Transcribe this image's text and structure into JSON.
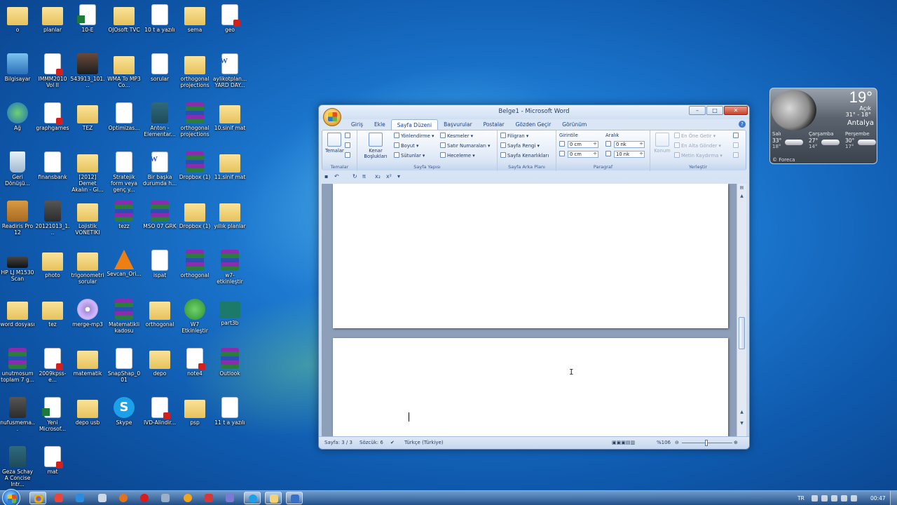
{
  "desktop": {
    "icons": [
      {
        "label": "o",
        "kind": "folder"
      },
      {
        "label": "planlar",
        "kind": "folder"
      },
      {
        "label": "10-E",
        "kind": "xls"
      },
      {
        "label": "OJOsoft TVC",
        "kind": "folder"
      },
      {
        "label": "10 t a yazılı",
        "kind": "doc"
      },
      {
        "label": "sema",
        "kind": "folder"
      },
      {
        "label": "geo",
        "kind": "pdf"
      },
      {
        "label": "Bilgisayar",
        "kind": "comp"
      },
      {
        "label": "IMMM2010 Vol II",
        "kind": "pdf"
      },
      {
        "label": "543913_101...",
        "kind": "photo"
      },
      {
        "label": "WMA To MP3 Co...",
        "kind": "folder"
      },
      {
        "label": "sorular",
        "kind": "doc"
      },
      {
        "label": "orthogonal projections",
        "kind": "folder"
      },
      {
        "label": "aylikotplan... YARD DAY...",
        "kind": "word"
      },
      {
        "label": "Ağ",
        "kind": "net"
      },
      {
        "label": "graphgames",
        "kind": "pdf"
      },
      {
        "label": "TEZ",
        "kind": "folder"
      },
      {
        "label": "Optimizas...",
        "kind": "doc"
      },
      {
        "label": "Anton - Elementar...",
        "kind": "book"
      },
      {
        "label": "orthogonal projections",
        "kind": "rar"
      },
      {
        "label": "10.sinif mat",
        "kind": "folder"
      },
      {
        "label": "Geri Dönüşü...",
        "kind": "bin"
      },
      {
        "label": "finansbank",
        "kind": "doc"
      },
      {
        "label": "[2012] Demet Akalın - Gi...",
        "kind": "folder"
      },
      {
        "label": "Stratejik form veya genç y...",
        "kind": "doc"
      },
      {
        "label": "Bir başka durumda h...",
        "kind": "word"
      },
      {
        "label": "Dropbox (1)",
        "kind": "rar"
      },
      {
        "label": "11.sinif mat",
        "kind": "folder"
      },
      {
        "label": "Readiris Pro 12",
        "kind": "box"
      },
      {
        "label": "20121013_1...",
        "kind": "dark"
      },
      {
        "label": "Lojistik VONETIKI",
        "kind": "folder"
      },
      {
        "label": "tezz",
        "kind": "rar"
      },
      {
        "label": "MSO 07 GRK",
        "kind": "rar"
      },
      {
        "label": "Dropbox (1)",
        "kind": "folder"
      },
      {
        "label": "yıllık planlar",
        "kind": "folder"
      },
      {
        "label": "HP LJ M1530 Scan",
        "kind": "scanner"
      },
      {
        "label": "photo",
        "kind": "folder"
      },
      {
        "label": "trigonometri sorular",
        "kind": "folder"
      },
      {
        "label": "Sevcan_Ori...",
        "kind": "vlc"
      },
      {
        "label": "ispat",
        "kind": "doc"
      },
      {
        "label": "orthogonal",
        "kind": "rar"
      },
      {
        "label": "w7-etkinleştir",
        "kind": "rar"
      },
      {
        "label": "word dosyası",
        "kind": "folder"
      },
      {
        "label": "tez",
        "kind": "folder"
      },
      {
        "label": "mergе-mp3",
        "kind": "disc"
      },
      {
        "label": "Matematikli kadosu",
        "kind": "rar"
      },
      {
        "label": "orthogonal",
        "kind": "folder"
      },
      {
        "label": "W7 Etkinleştir",
        "kind": "green"
      },
      {
        "label": "part3b",
        "kind": "teal"
      },
      {
        "label": "unutmosum toplam 7 g...",
        "kind": "rar"
      },
      {
        "label": "2009kpss-e...",
        "kind": "pdf"
      },
      {
        "label": "matematik",
        "kind": "folder"
      },
      {
        "label": "SnapShap_001",
        "kind": "doc"
      },
      {
        "label": "depo",
        "kind": "folder"
      },
      {
        "label": "note4",
        "kind": "pdf"
      },
      {
        "label": "Outlook",
        "kind": "rar"
      },
      {
        "label": "nufusmema...",
        "kind": "dark"
      },
      {
        "label": "Yeni Microsof...",
        "kind": "xls"
      },
      {
        "label": "depo usb",
        "kind": "folder"
      },
      {
        "label": "Skype",
        "kind": "skype"
      },
      {
        "label": "IVD-Alindir...",
        "kind": "pdf"
      },
      {
        "label": "psp",
        "kind": "folder"
      },
      {
        "label": "11 t a yazılı",
        "kind": "doc"
      },
      {
        "label": "Geza Schay A Concise Intr...",
        "kind": "book"
      },
      {
        "label": "mat",
        "kind": "pdf"
      }
    ]
  },
  "weather": {
    "temp": "19°",
    "condition": "Açık",
    "range": "31° - 18°",
    "city": "Antalya",
    "days": [
      {
        "name": "Salı",
        "hi": "33°",
        "lo": "18°"
      },
      {
        "name": "Çarşamba",
        "hi": "27°",
        "lo": "14°"
      },
      {
        "name": "Perşembe",
        "hi": "30°",
        "lo": "17°"
      }
    ],
    "footer": "© Foreca"
  },
  "word": {
    "title": "Belge1 - Microsoft Word",
    "window_buttons": [
      "–",
      "□",
      "✕"
    ],
    "tabs": [
      "Giriş",
      "Ekle",
      "Sayfa Düzeni",
      "Başvurular",
      "Postalar",
      "Gözden Geçir",
      "Görünüm"
    ],
    "active_tab": "Sayfa Düzeni",
    "ribbon": {
      "temalar": {
        "button": "Temalar",
        "group": "Temalar"
      },
      "sayfa_yapisi": {
        "kenar": "Kenar Boşlukları",
        "yonlendirme": "Yönlendirme",
        "boyut": "Boyut",
        "sutunlar": "Sütunlar",
        "kesmeler": "Kesmeler",
        "satir_numaralari": "Satır Numaraları",
        "heceleme": "Heceleme",
        "group": "Sayfa Yapısı"
      },
      "sayfa_arka_plani": {
        "filigran": "Filigran",
        "sayfa_rengi": "Sayfa Rengi",
        "sayfa_kenarliklari": "Sayfa Kenarlıkları",
        "group": "Sayfa Arka Planı"
      },
      "paragraf": {
        "girintile": "Girintile",
        "girinti_sol": "0 cm",
        "girinti_sag": "0 cm",
        "aralik": "Aralık",
        "aralik_once": "0 nk",
        "aralik_sonra": "10 nk",
        "group": "Paragraf"
      },
      "yerlestir": {
        "konum": "Konum",
        "en_one_getir": "En Öne Getir",
        "en_alta_gonder": "En Alta Gönder",
        "metin_kaydirma": "Metin Kaydırma",
        "group": "Yerleştir"
      }
    },
    "status": {
      "page": "Sayfa: 3 / 3",
      "words": "Sözcük: 6",
      "language": "Türkçe (Türkiye)",
      "zoom": "%106"
    }
  },
  "taskbar": {
    "lang": "TR",
    "time": "00:47"
  }
}
